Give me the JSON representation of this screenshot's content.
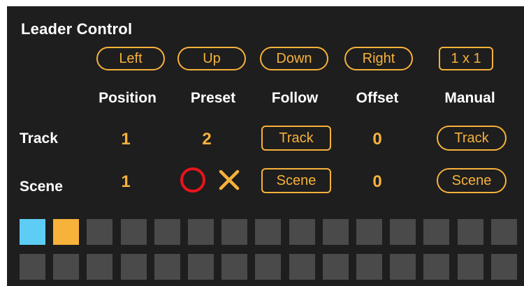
{
  "title": "Leader Control",
  "nav_buttons": {
    "left": "Left",
    "up": "Up",
    "down": "Down",
    "right": "Right",
    "manual_size": "1 x 1"
  },
  "columns": {
    "position": "Position",
    "preset": "Preset",
    "follow": "Follow",
    "offset": "Offset",
    "manual": "Manual"
  },
  "rows": {
    "track": {
      "label": "Track",
      "position": "1",
      "preset": "2",
      "follow_button": "Track",
      "offset": "0",
      "manual_button": "Track"
    },
    "scene": {
      "label": "Scene",
      "position": "1",
      "preset_icons": [
        "circle-icon",
        "close-icon"
      ],
      "follow_button": "Scene",
      "offset": "0",
      "manual_button": "Scene"
    }
  },
  "grid": {
    "rows": 2,
    "columns": 15,
    "active_cells": [
      {
        "row": 0,
        "col": 0,
        "color": "#5ecdf5"
      },
      {
        "row": 0,
        "col": 1,
        "color": "#f7b23b"
      }
    ],
    "inactive_color": "#4a4a4a"
  },
  "colors": {
    "accent": "#f7b23b",
    "background": "#1e1e1e",
    "text": "#ffffff",
    "circle": "#e8141c"
  }
}
